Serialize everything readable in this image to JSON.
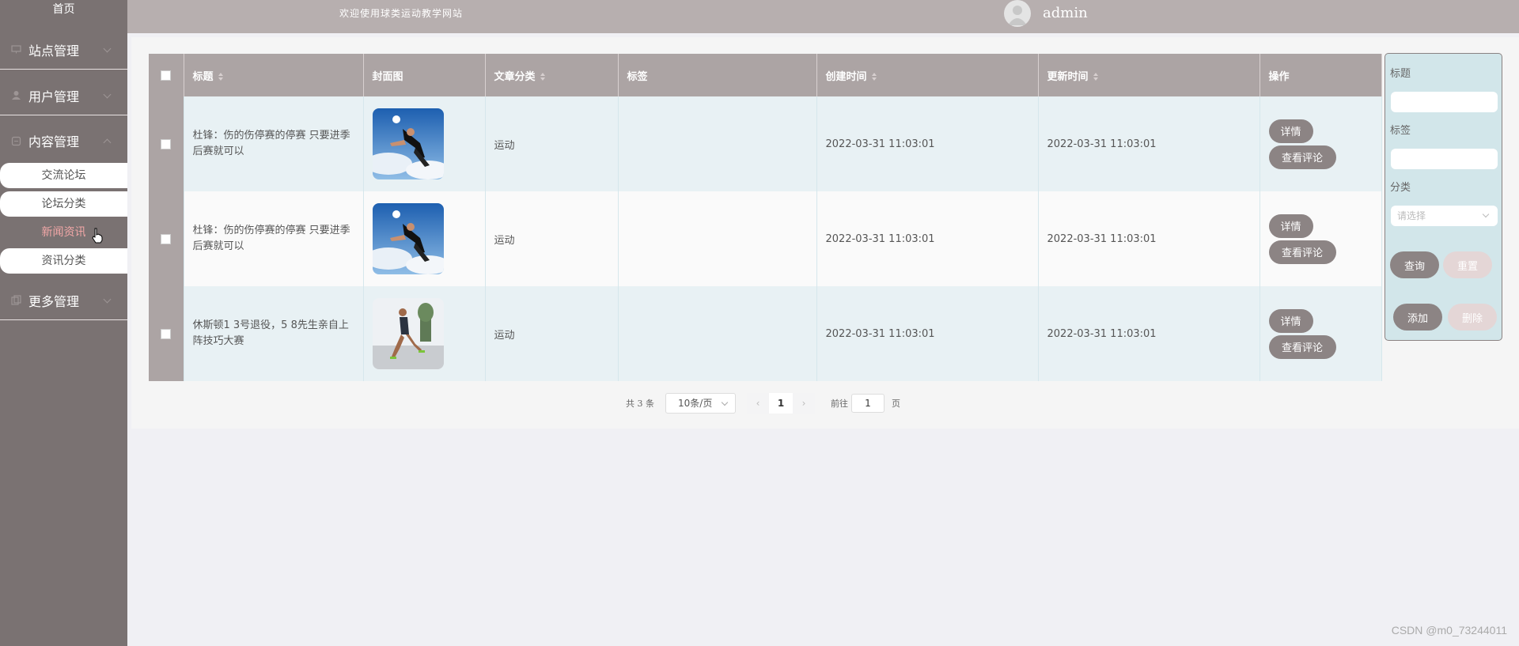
{
  "sidebar": {
    "home": "首页",
    "groups": [
      {
        "label": "站点管理",
        "icon": "monitor-icon"
      },
      {
        "label": "用户管理",
        "icon": "user-icon"
      },
      {
        "label": "内容管理",
        "icon": "document-icon"
      },
      {
        "label": "更多管理",
        "icon": "copy-icon"
      }
    ],
    "content_subitems": [
      "交流论坛",
      "论坛分类",
      "新闻资讯",
      "资讯分类"
    ],
    "active_subitem": "新闻资讯"
  },
  "header": {
    "welcome": "欢迎使用球类运动教学网站",
    "username": "admin"
  },
  "table": {
    "columns": [
      "标题",
      "封面图",
      "文章分类",
      "标签",
      "创建时间",
      "更新时间",
      "操作"
    ],
    "rows": [
      {
        "title": "杜锋：伤的伤停赛的停赛 只要进季后赛就可以",
        "cover": "soccer-kick-image",
        "category": "运动",
        "tag": "",
        "created": "2022-03-31 11:03:01",
        "updated": "2022-03-31 11:03:01"
      },
      {
        "title": "杜锋：伤的伤停赛的停赛 只要进季后赛就可以",
        "cover": "soccer-kick-image",
        "category": "运动",
        "tag": "",
        "created": "2022-03-31 11:03:01",
        "updated": "2022-03-31 11:03:01"
      },
      {
        "title": "休斯顿1 3号退役，5 8先生亲自上阵技巧大赛",
        "cover": "runner-image",
        "category": "运动",
        "tag": "",
        "created": "2022-03-31 11:03:01",
        "updated": "2022-03-31 11:03:01"
      }
    ],
    "actions": {
      "detail": "详情",
      "comments": "查看评论"
    }
  },
  "pager": {
    "total": "共 3 条",
    "page_size": "10条/页",
    "prev": "‹",
    "current_page": "1",
    "next": "›",
    "goto_label": "前往",
    "goto_value": "1",
    "goto_unit": "页"
  },
  "search": {
    "title_label": "标题",
    "tag_label": "标签",
    "category_label": "分类",
    "category_placeholder": "请选择",
    "query": "查询",
    "reset": "重置",
    "add": "添加",
    "delete": "删除"
  },
  "watermark": "CSDN @m0_73244011",
  "colors": {
    "sidebar": "#7a7272",
    "header": "#b7afaf",
    "button": "#8c8484",
    "row_tint": "#e8f1f4"
  }
}
